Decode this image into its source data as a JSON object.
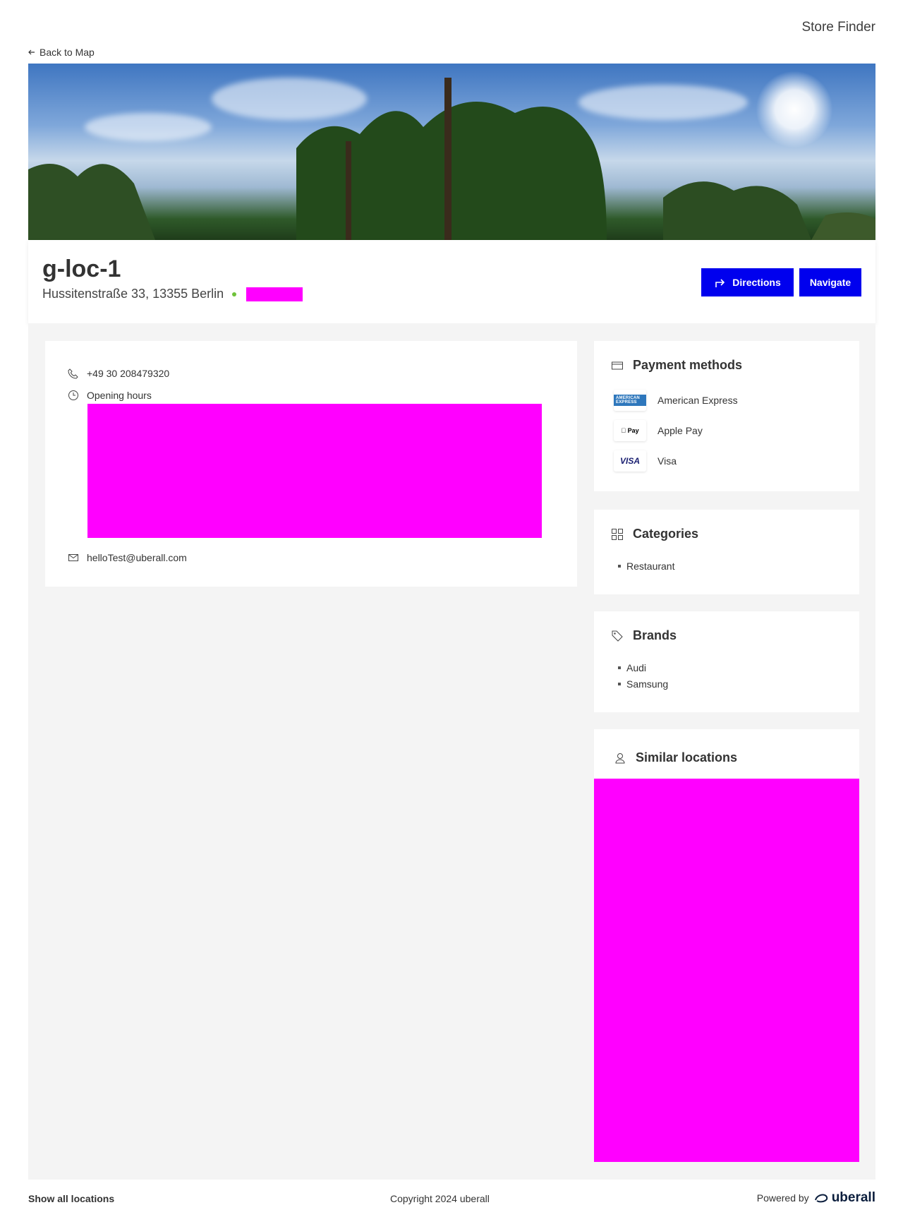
{
  "header": {
    "app_title": "Store Finder",
    "back_label": "Back to Map"
  },
  "location": {
    "name": "g-loc-1",
    "address": "Hussitenstraße 33, 13355 Berlin",
    "phone": "+49 30 208479320",
    "hours_label": "Opening hours",
    "email": "helloTest@uberall.com"
  },
  "actions": {
    "directions_label": "Directions",
    "navigate_label": "Navigate",
    "accent_color": "#0000ee"
  },
  "payment": {
    "title": "Payment methods",
    "methods": [
      {
        "label": "American Express",
        "logo": "AMERICAN EXPRESS"
      },
      {
        "label": "Apple Pay",
        "logo": "Pay"
      },
      {
        "label": "Visa",
        "logo": "VISA"
      }
    ]
  },
  "categories": {
    "title": "Categories",
    "items": [
      "Restaurant"
    ]
  },
  "brands": {
    "title": "Brands",
    "items": [
      "Audi",
      "Samsung"
    ]
  },
  "similar": {
    "title": "Similar locations"
  },
  "footer": {
    "show_all": "Show all locations",
    "copyright": "Copyright 2024 uberall",
    "powered_by": "Powered by",
    "brand": "uberall"
  },
  "colors": {
    "redaction": "#ff00ff",
    "status_open": "#6fc23a",
    "background": "#f4f4f4"
  }
}
